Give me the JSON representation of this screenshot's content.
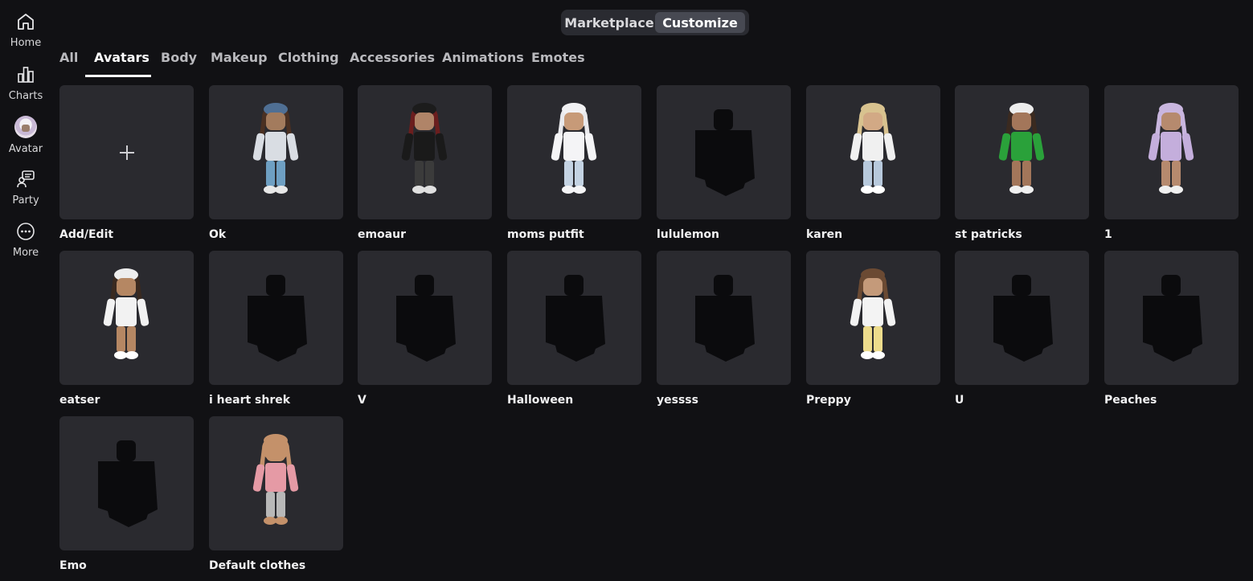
{
  "sidebar": {
    "items": [
      {
        "label": "Home",
        "icon": "home-icon"
      },
      {
        "label": "Charts",
        "icon": "charts-icon"
      },
      {
        "label": "Avatar",
        "icon": "avatar-icon"
      },
      {
        "label": "Party",
        "icon": "party-icon"
      },
      {
        "label": "More",
        "icon": "more-icon"
      }
    ]
  },
  "header": {
    "marketplace_label": "Marketplace",
    "customize_label": "Customize",
    "selected": "Customize"
  },
  "tabs": {
    "items": [
      "All",
      "Avatars",
      "Body",
      "Makeup",
      "Clothing",
      "Accessories",
      "Animations",
      "Emotes"
    ],
    "active": "Avatars"
  },
  "outfits": [
    {
      "label": "Add/Edit",
      "kind": "add"
    },
    {
      "label": "Ok",
      "kind": "figure",
      "colors": {
        "hair": "#4a3022",
        "hat": "#4f6f94",
        "skin": "#a37b5d",
        "top": "#d9dde3",
        "legs": "#6e9fc2",
        "shoes": "#e8e8e8"
      }
    },
    {
      "label": "emoaur",
      "kind": "figure",
      "colors": {
        "hair": "#6b1e1e",
        "hat": "#1c1c1c",
        "skin": "#b08468",
        "top": "#1a1a1a",
        "legs": "#3b3b3b",
        "shoes": "#e0e0e0"
      }
    },
    {
      "label": "moms putfit",
      "kind": "figure",
      "colors": {
        "hair": "#e9e9ec",
        "hat": "#f1f1f3",
        "skin": "#c79a78",
        "top": "#f4f4f6",
        "legs": "#c4d3e3",
        "shoes": "#f4f4f6"
      }
    },
    {
      "label": "lululemon",
      "kind": "silhouette"
    },
    {
      "label": "karen",
      "kind": "figure",
      "colors": {
        "hair": "#d8c28f",
        "hat": "#d8c28f",
        "skin": "#d2a985",
        "top": "#f0f0f0",
        "legs": "#b7c9dc",
        "shoes": "#ffffff"
      }
    },
    {
      "label": "st patricks",
      "kind": "figure",
      "colors": {
        "hair": "#3a2a20",
        "hat": "#ededed",
        "skin": "#a3765a",
        "top": "#2aa13a",
        "legs": "#a3765a",
        "shoes": "#f0f0f0"
      }
    },
    {
      "label": "1",
      "kind": "figure",
      "colors": {
        "hair": "#c9b6df",
        "hat": "#c9b6df",
        "skin": "#b68a6e",
        "top": "#c4aedc",
        "legs": "#b68a6e",
        "shoes": "#f0f0f0"
      }
    },
    {
      "label": "eatser",
      "kind": "figure",
      "colors": {
        "hair": "#3a2a20",
        "hat": "#ededed",
        "skin": "#b58763",
        "top": "#f2f2f2",
        "legs": "#b58763",
        "shoes": "#ffffff"
      }
    },
    {
      "label": "i heart shrek",
      "kind": "silhouette"
    },
    {
      "label": "V",
      "kind": "silhouette"
    },
    {
      "label": "Halloween",
      "kind": "silhouette"
    },
    {
      "label": "yessss",
      "kind": "silhouette"
    },
    {
      "label": "Preppy",
      "kind": "figure",
      "colors": {
        "hair": "#6b4a33",
        "hat": "#6b4a33",
        "skin": "#c49a7a",
        "top": "#f3f3f3",
        "legs": "#eddc8c",
        "shoes": "#ffffff"
      }
    },
    {
      "label": "U",
      "kind": "silhouette"
    },
    {
      "label": "Peaches",
      "kind": "silhouette"
    },
    {
      "label": "Emo",
      "kind": "silhouette"
    },
    {
      "label": "Default clothes",
      "kind": "figure",
      "colors": {
        "hair": "#c4916a",
        "hat": "#c4916a",
        "skin": "#c4916a",
        "top": "#e59aa5",
        "legs": "#b8b8b8",
        "shoes": "#c4916a"
      }
    }
  ],
  "colors": {
    "background": "#111114",
    "tile": "#2a2a2f",
    "silhouette": "#0b0b0d"
  }
}
